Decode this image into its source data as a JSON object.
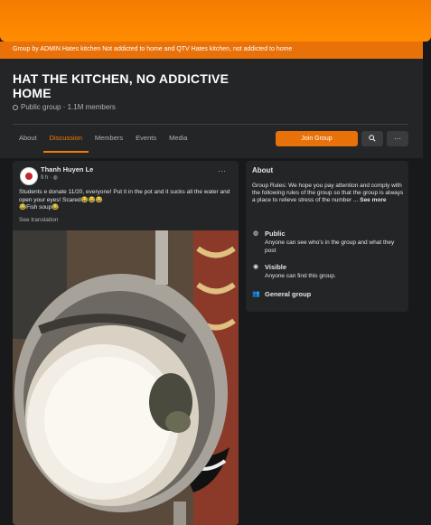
{
  "cover": {
    "banner_text": "Group by ADMIN Hates kitchen Not addicted to home and QTV Hates kitchen, not addicted to home"
  },
  "group": {
    "title": "HAT THE KITCHEN, NO ADDICTIVE HOME",
    "meta": "Public group · 1.1M members"
  },
  "tabs": [
    "About",
    "Discussion",
    "Members",
    "Events",
    "Media"
  ],
  "active_tab": "Discussion",
  "actions": {
    "join_label": "Join Group",
    "search_icon": "search-icon",
    "more_icon": "more-icon"
  },
  "post": {
    "author": "Thanh Huyen Le",
    "time": "9 h · ",
    "text_line1": "Students e donate 11/20, everyone! Put it in the pot and it sucks all the water and open your eyes! Scared😂😂😂",
    "text_line2": "😂Fish soup😂",
    "see_translation": "See translation"
  },
  "about": {
    "title": "About",
    "rules": "Group Rules: We hope you pay attention and comply with the following rules of the group so that the group is always a place to relieve stress of the number ...",
    "see_more": "See more",
    "public_title": "Public",
    "public_desc": "Anyone can see who's in the group and what they post",
    "visible_title": "Visible",
    "visible_desc": "Anyone can find this group.",
    "general_title": "General group"
  },
  "colors": {
    "accent": "#e8710a",
    "background": "#18191a",
    "card": "#242526"
  }
}
